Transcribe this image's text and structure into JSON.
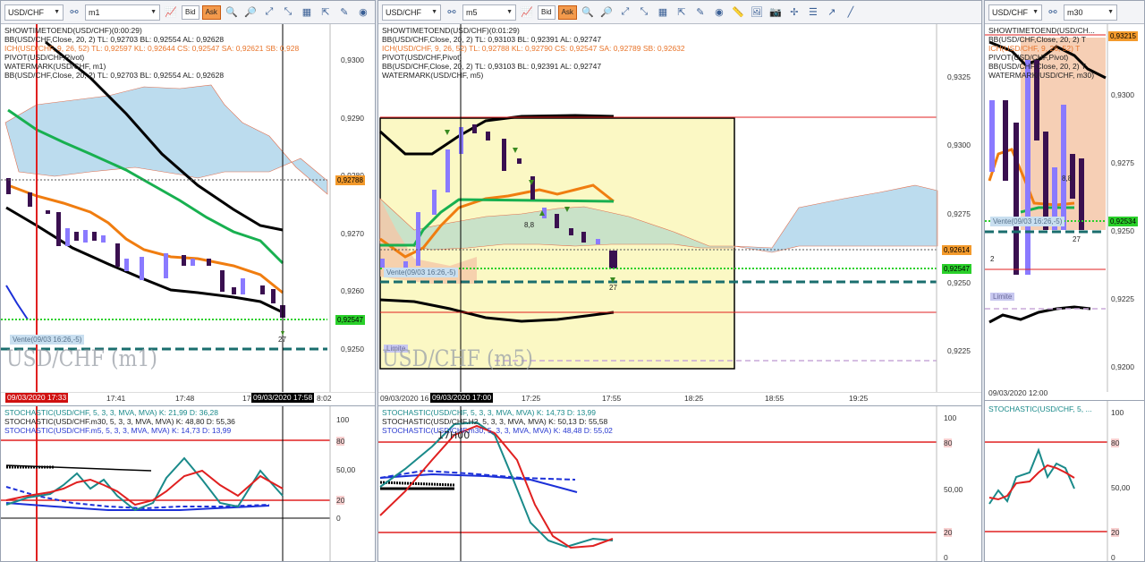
{
  "panels": [
    {
      "symbol": "USD/CHF",
      "timeframe": "m1",
      "bid_label": "Bid",
      "ask_label": "Ask",
      "legend": [
        {
          "text": "SHOWTIMETOEND(USD/CHF)(0:00:29)",
          "color": "#222"
        },
        {
          "text": "BB(USD/CHF,Close, 20, 2)  TL: 0,92703  BL: 0,92554  AL: 0,92628",
          "color": "#222"
        },
        {
          "text": "ICH(USD/CHF, 9, 26, 52)  TL: 0,92597  KL: 0,92644  CS: 0,92547  SA: 0,92621  SB: 0,928",
          "color": "#e8742a"
        },
        {
          "text": "PIVOT(USD/CHF,Pivot)",
          "color": "#222"
        },
        {
          "text": "WATERMARK(USD/CHF, m1)",
          "color": "#222"
        },
        {
          "text": "BB(USD/CHF,Close, 20, 2)  TL: 0,92703  BL: 0,92554  AL: 0,92628",
          "color": "#222"
        }
      ],
      "price_axis": [
        "0,9300",
        "0,9290",
        "0,9280",
        "0,9270",
        "0,9260",
        "0,9250"
      ],
      "price_tags": [
        {
          "value": "0,92788",
          "bg": "#f39a2c"
        },
        {
          "value": "0,92547",
          "bg": "#2ad02a"
        }
      ],
      "vente_label": "Vente(09/03 16:26,-5)",
      "watermark": "USD/CHF (m1)",
      "arrow_label": "27",
      "time_labels": [
        "17:41",
        "17:48",
        "17",
        "8:02"
      ],
      "time_highlight_left": "09/03/2020 17:33",
      "time_highlight_right": "09/03/2020 17:58",
      "osc_legend": [
        {
          "text": "STOCHASTIC(USD/CHF, 5, 3, 3, MVA, MVA)  K: 21,99  D: 36,28",
          "color": "#1a8a8a"
        },
        {
          "text": "STOCHASTIC(USD/CHF.m30, 5, 3, 3, MVA, MVA)  K: 48,80  D: 55,36",
          "color": "#222"
        },
        {
          "text": "STOCHASTIC(USD/CHF.m5, 5, 3, 3, MVA, MVA)  K: 14,73  D: 13,99",
          "color": "#2a3ad0"
        }
      ],
      "osc_axis": [
        "100",
        "80",
        "50,00",
        "20",
        "0"
      ]
    },
    {
      "symbol": "USD/CHF",
      "timeframe": "m5",
      "bid_label": "Bid",
      "ask_label": "Ask",
      "legend": [
        {
          "text": "SHOWTIMETOEND(USD/CHF)(0:01:29)",
          "color": "#222"
        },
        {
          "text": "BB(USD/CHF,Close, 20, 2)  TL: 0,93103  BL: 0,92391  AL: 0,92747",
          "color": "#222"
        },
        {
          "text": "ICH(USD/CHF, 9, 26, 52)  TL: 0,92788  KL: 0,92790  CS: 0,92547  SA: 0,92789  SB: 0,92632",
          "color": "#e8742a"
        },
        {
          "text": "PIVOT(USD/CHF,Pivot)",
          "color": "#222"
        },
        {
          "text": "BB(USD/CHF,Close, 20, 2)  TL: 0,93103  BL: 0,92391  AL: 0,92747",
          "color": "#222"
        },
        {
          "text": "WATERMARK(USD/CHF, m5)",
          "color": "#222"
        }
      ],
      "price_axis": [
        "0,9325",
        "0,9300",
        "0,9275",
        "0,9250",
        "0,9225"
      ],
      "price_tags": [
        {
          "value": "0,92614",
          "bg": "#f39a2c"
        },
        {
          "value": "0,92547",
          "bg": "#2ad02a"
        }
      ],
      "vente_label": "Vente(09/03 16:26,-5)",
      "watermark": "USD/CHF (m5)",
      "limite_label": "Limite",
      "arrow_label": "27",
      "pivot_label": "8,8",
      "time_labels": [
        "09/03/2020 16",
        "17:25",
        "17:55",
        "18:25",
        "18:55",
        "19:25"
      ],
      "time_highlight": "09/03/2020 17:00",
      "osc_marker": "17H00",
      "osc_legend": [
        {
          "text": "STOCHASTIC(USD/CHF, 5, 3, 3, MVA, MVA)  K: 14,73  D: 13,99",
          "color": "#1a8a8a"
        },
        {
          "text": "STOCHASTIC(USD/CHF.H2, 5, 3, 3, MVA, MVA)  K: 50,13  D: 55,58",
          "color": "#222"
        },
        {
          "text": "STOCHASTIC(USD/CHF.m30, 5, 3, 3, MVA, MVA)  K: 48,48  D: 55,02",
          "color": "#2a3ad0"
        }
      ],
      "osc_axis": [
        "100",
        "80",
        "50,00",
        "20",
        "0"
      ]
    },
    {
      "symbol": "USD/CHF",
      "timeframe": "m30",
      "legend": [
        {
          "text": "SHOWTIMETOEND(USD/CH...",
          "color": "#222"
        },
        {
          "text": "BB(USD/CHF,Close, 20, 2)  T",
          "color": "#222"
        },
        {
          "text": "ICH(USD/CHF, 9, 26, 52)  T",
          "color": "#e8742a"
        },
        {
          "text": "PIVOT(USD/CHF,Pivot)",
          "color": "#222"
        },
        {
          "text": "BB(USD/CHF,Close, 20, 2)  T",
          "color": "#222"
        },
        {
          "text": "WATERMARK(USD/CHF, m30)",
          "color": "#222"
        }
      ],
      "price_axis": [
        "0,9300",
        "0,9275",
        "0,9250",
        "0,9225",
        "0,9200"
      ],
      "price_tags": [
        {
          "value": "0,93215",
          "bg": "#f39a2c"
        },
        {
          "value": "0,92534",
          "bg": "#2ad02a"
        }
      ],
      "vente_label": "Vente(09/03 16:26,-5)",
      "limite_label": "Limite",
      "arrow_label": "27",
      "pivot_label": "8,8",
      "side_label": "2",
      "time_labels": [
        "09/03/2020 12:00"
      ],
      "osc_legend": [
        {
          "text": "STOCHASTIC(USD/CHF, 5, ...",
          "color": "#1a8a8a"
        }
      ],
      "osc_axis": [
        "100",
        "80",
        "50,00",
        "20",
        "0"
      ]
    }
  ],
  "colors": {
    "bb": "#000000",
    "tenkan": "#f07d10",
    "kijun": "#18b050",
    "stoch_k": "#1a8a8a",
    "stoch_d": "#e02020",
    "stoch_blue": "#1c30d8",
    "bull_candle": "#8a7aff",
    "bear_candle": "#3a1050",
    "cloud_blue": "#bcdcee",
    "cloud_orange": "#f5c7a8",
    "highlight_box": "#fbf8c4"
  }
}
